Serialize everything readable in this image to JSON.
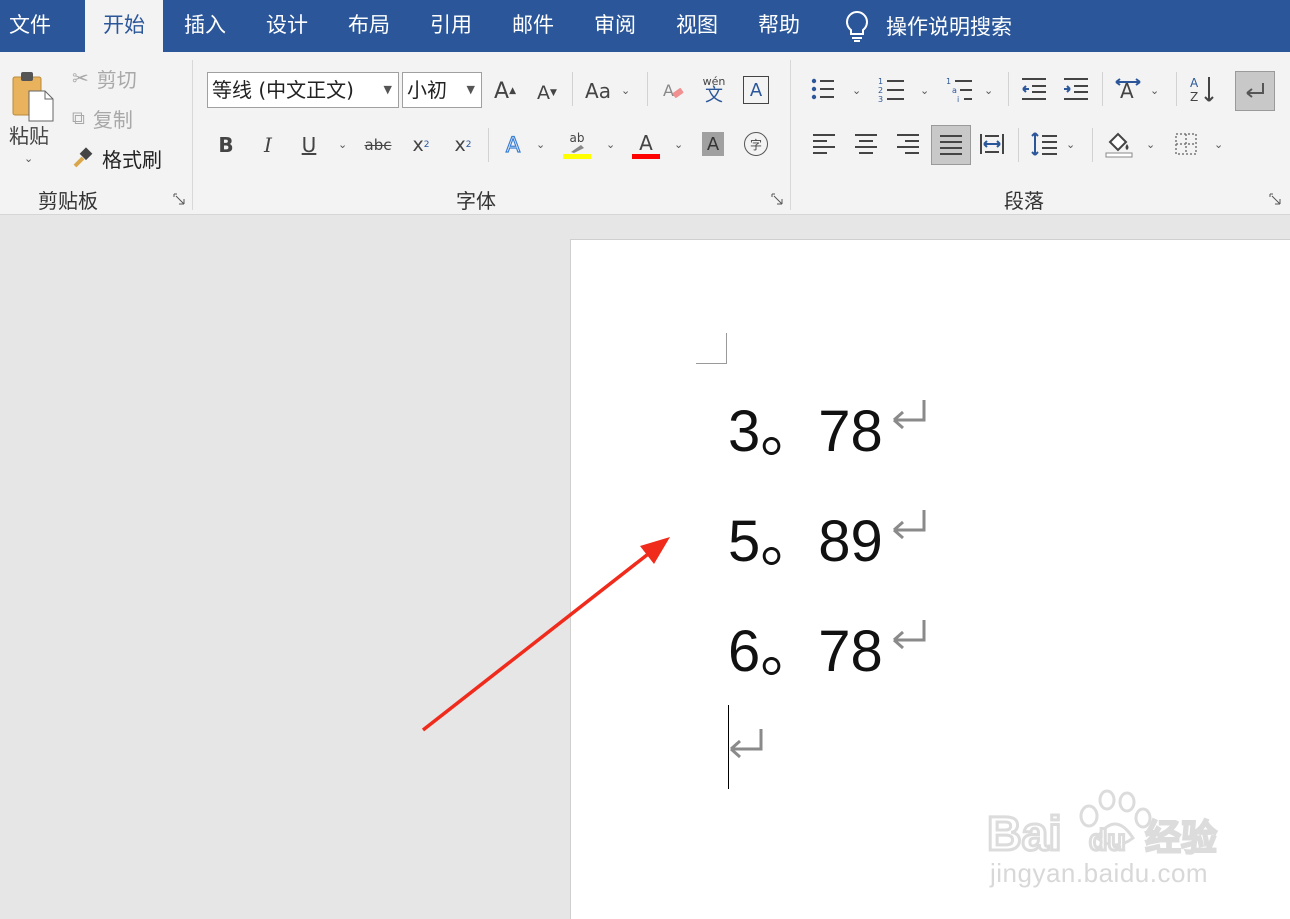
{
  "tabs": {
    "file": "文件",
    "home": "开始",
    "insert": "插入",
    "design": "设计",
    "layout": "布局",
    "references": "引用",
    "mailings": "邮件",
    "review": "审阅",
    "view": "视图",
    "help": "帮助",
    "tell_me": "操作说明搜索"
  },
  "clipboard": {
    "paste": "粘贴",
    "cut": "剪切",
    "copy": "复制",
    "format_painter": "格式刷",
    "group_label": "剪贴板"
  },
  "font": {
    "font_name": "等线 (中文正文)",
    "font_size": "小初",
    "group_label": "字体",
    "grow_glyph": "A",
    "shrink_glyph": "A",
    "case_glyph": "Aa",
    "phonetic_top": "wén",
    "phonetic_bottom": "文",
    "bold": "B",
    "italic": "I",
    "underline": "U",
    "strike": "abc",
    "sub": "x",
    "sup": "x",
    "char_border": "A",
    "effects": "A",
    "highlight": "ab",
    "font_color": "A",
    "shading": "A",
    "enclose": "字"
  },
  "paragraph": {
    "group_label": "段落"
  },
  "document": {
    "lines": [
      {
        "num": "3",
        "sep": "。",
        "value": "78"
      },
      {
        "num": "5",
        "sep": "。",
        "value": "89"
      },
      {
        "num": "6",
        "sep": "。",
        "value": "78"
      }
    ]
  },
  "watermark": {
    "url": "jingyan.baidu.com"
  },
  "colors": {
    "ribbon_blue": "#2b579a",
    "highlight_yellow": "#ffff00",
    "font_red": "#ff0000",
    "arrow_red": "#f02b1c"
  }
}
